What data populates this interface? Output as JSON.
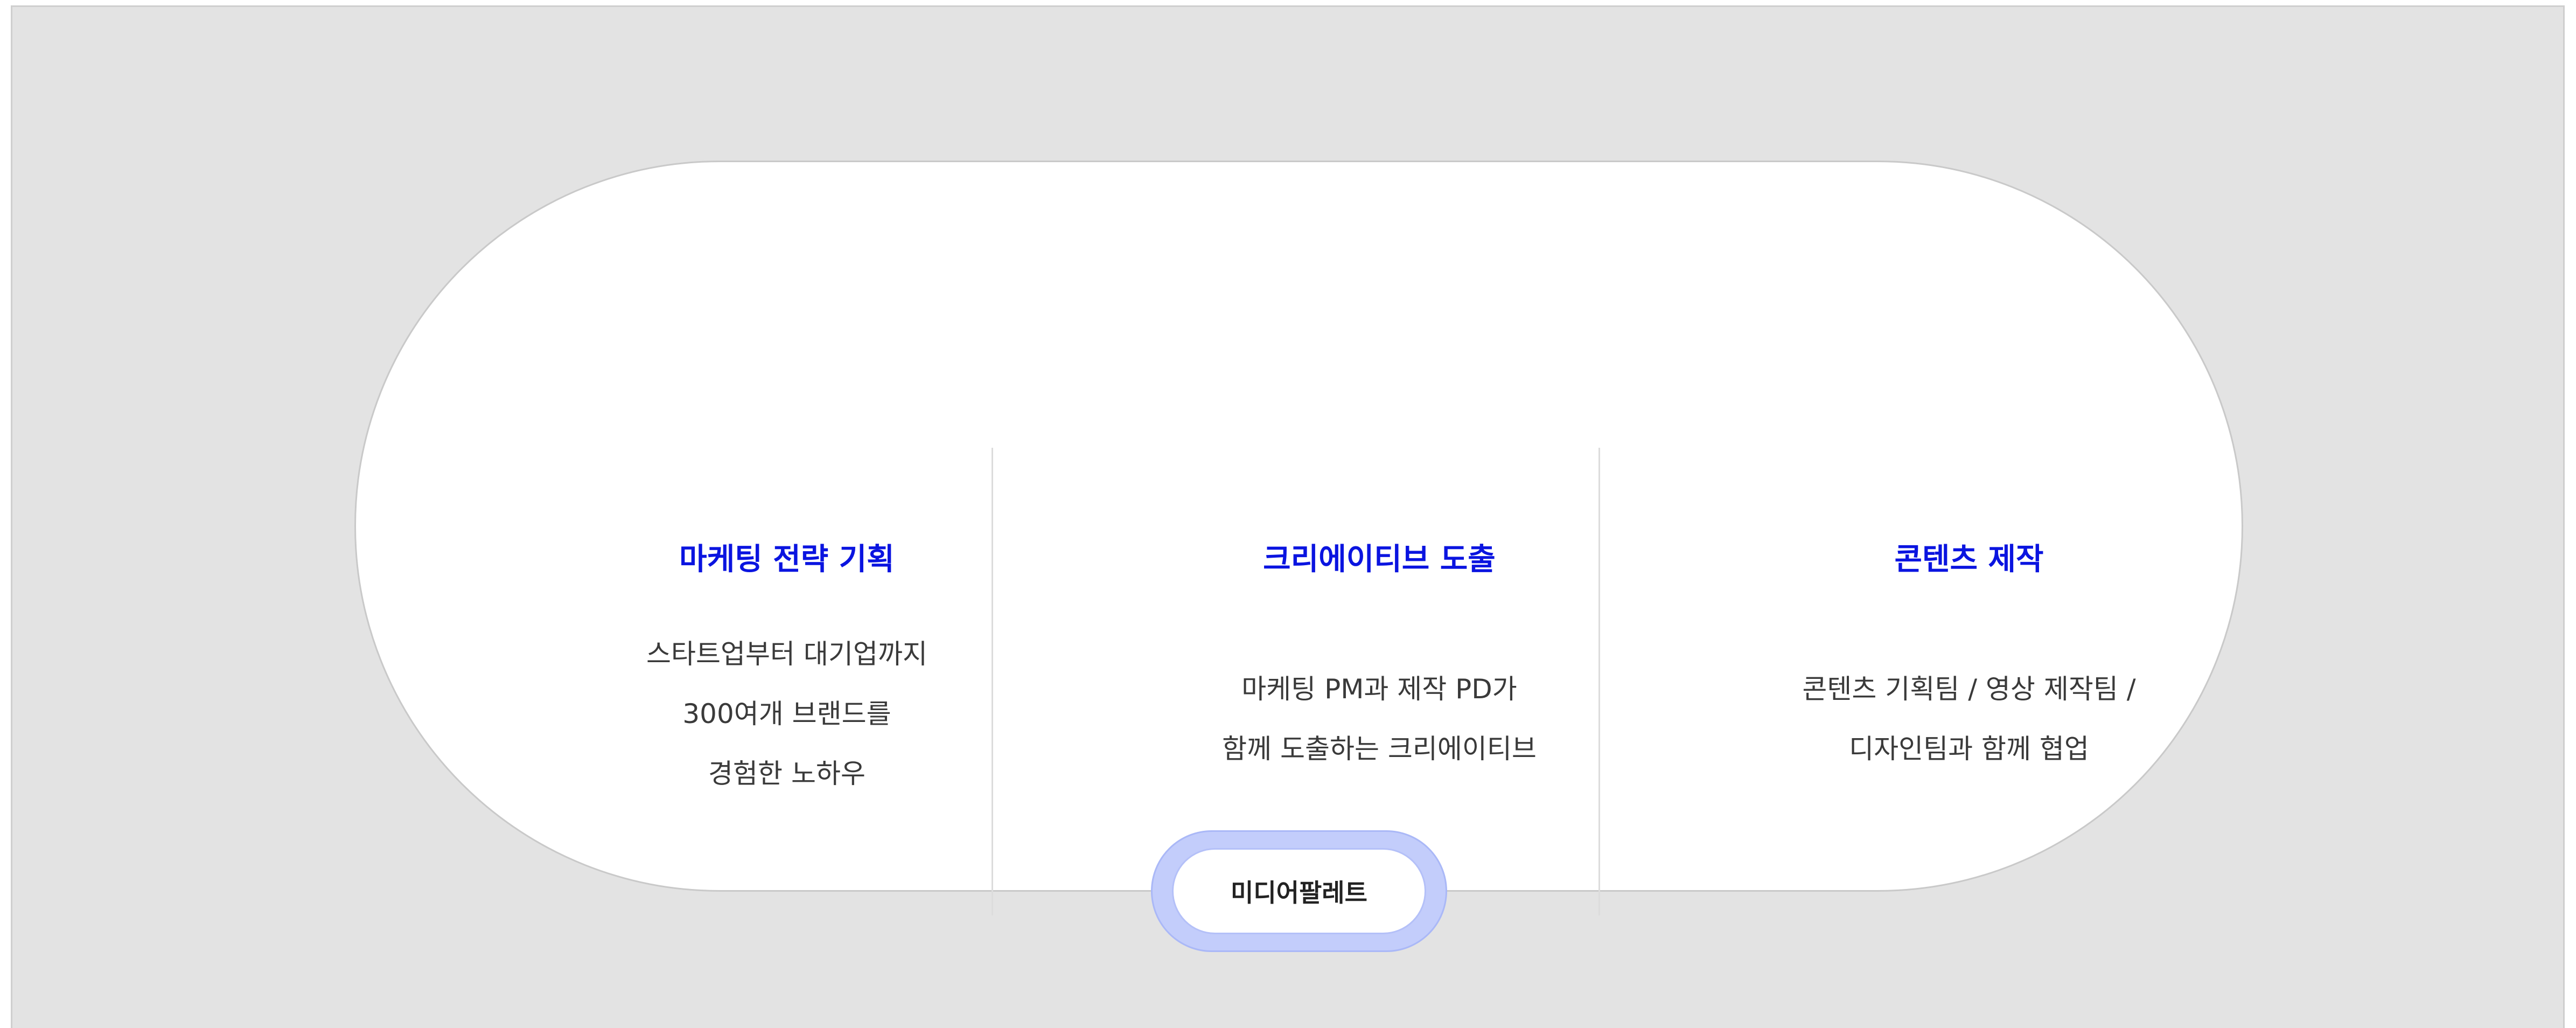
{
  "columns": [
    {
      "title": "마케팅 전략 기획",
      "lines": [
        "스타트업부터 대기업까지",
        "300여개 브랜드를",
        "경험한 노하우"
      ]
    },
    {
      "title": "크리에이티브 도출",
      "lines": [
        "마케팅 PM과 제작 PD가",
        "함께 도출하는 크리에이티브"
      ]
    },
    {
      "title": "콘텐츠 제작",
      "lines": [
        "콘텐츠 기획팀 / 영상 제작팀 /",
        "디자인팀과 함께 협업"
      ]
    }
  ],
  "badge": {
    "label": "미디어팔레트"
  },
  "colors": {
    "title_accent": "#0a14e0",
    "badge_ring": "#c3cdfb",
    "background": "#e3e3e3"
  }
}
